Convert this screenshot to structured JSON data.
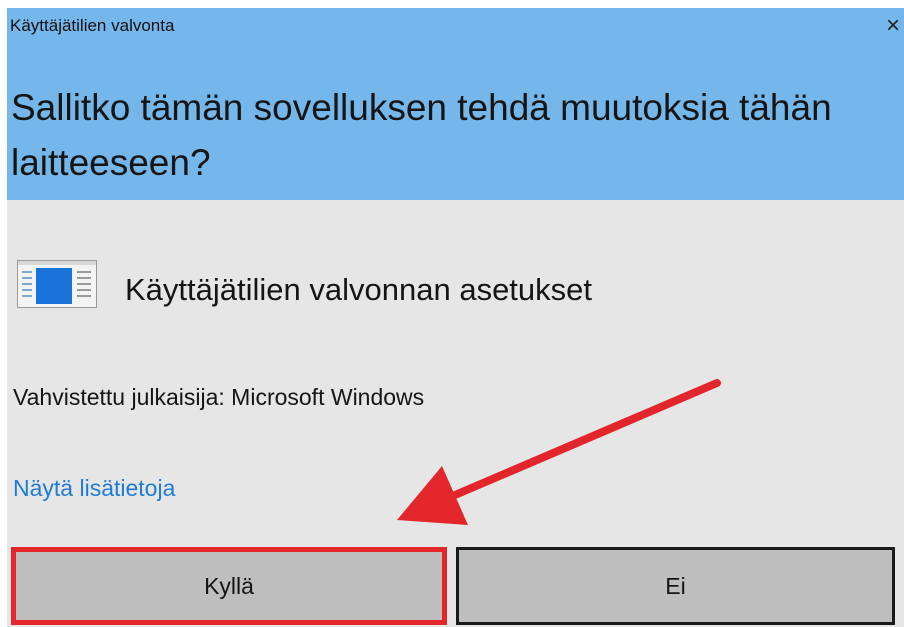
{
  "dialog": {
    "window_title": "Käyttäjätilien valvonta",
    "question": "Sallitko tämän sovelluksen tehdä muutoksia tähän laitteeseen?",
    "app_name": "Käyttäjätilien valvonnan asetukset",
    "publisher": "Vahvistettu julkaisija: Microsoft Windows",
    "details_link": "Näytä lisätietoja",
    "close_glyph": "×",
    "buttons": {
      "yes": "Kyllä",
      "no": "Ei"
    }
  },
  "icons": {
    "close": "close-icon",
    "app": "window-settings-icon"
  },
  "colors": {
    "header_bg": "#75b7ea",
    "body_bg": "#e6e6e6",
    "button_bg": "#bebebe",
    "link": "#1e7bd8",
    "highlight": "#e3262c"
  },
  "annotation": {
    "arrow_color": "#e3262c"
  }
}
